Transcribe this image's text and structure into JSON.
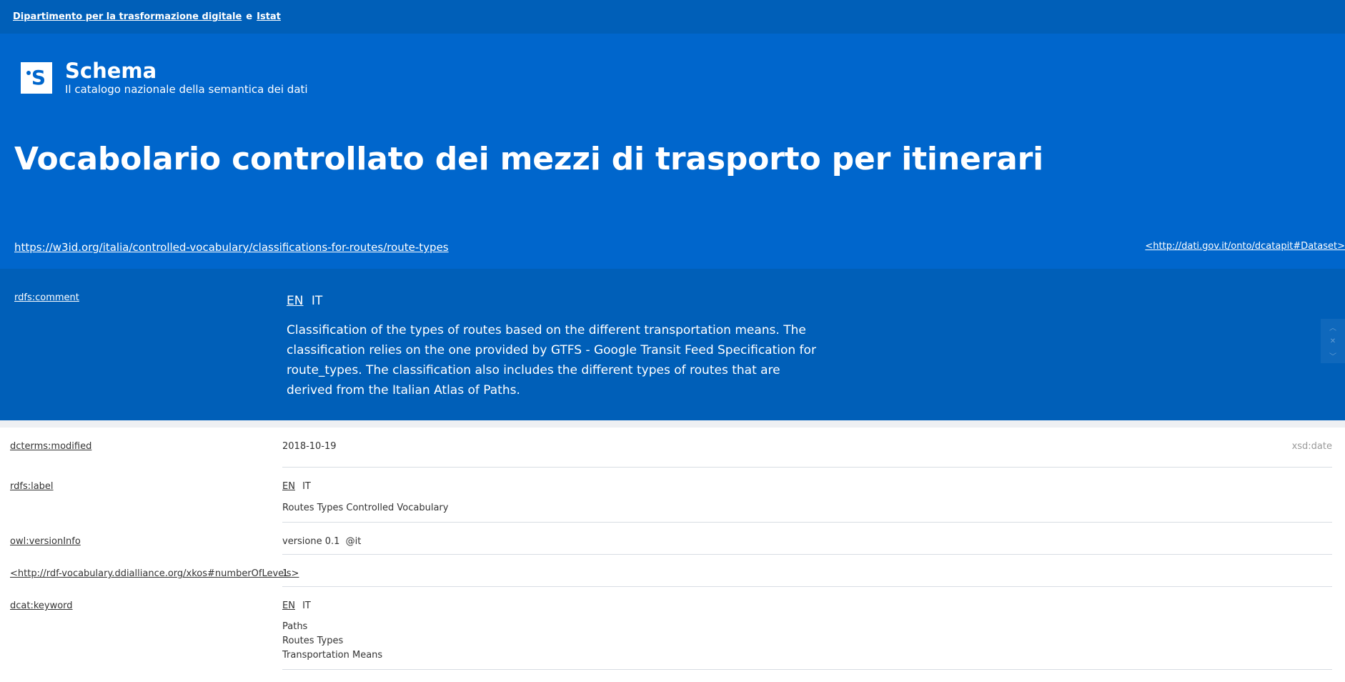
{
  "topbar": {
    "org1": "Dipartimento per la trasformazione digitale",
    "and": "e",
    "org2": "Istat"
  },
  "brand": {
    "title": "Schema",
    "subtitle": "Il catalogo nazionale della semantica dei dati",
    "logo_letter": "S"
  },
  "page": {
    "title": "Vocabolario controllato dei mezzi di trasporto per itinerari",
    "uri": "https://w3id.org/italia/controlled-vocabulary/classifications-for-routes/route-types",
    "type_uri": "<http://dati.gov.it/onto/dcatapit#Dataset>"
  },
  "comment": {
    "prop": "rdfs:comment",
    "lang_en": "EN",
    "lang_it": "IT",
    "text": "Classification of the types of routes based on the different transportation means. The classification relies on the one provided by GTFS - Google Transit Feed Specification for route_types. The classification also includes the different types of routes that are derived from the Italian Atlas of Paths."
  },
  "properties": {
    "modified": {
      "key": "dcterms:modified",
      "value": "2018-10-19",
      "type": "xsd:date"
    },
    "label": {
      "key": "rdfs:label",
      "lang_en": "EN",
      "lang_it": "IT",
      "value": "Routes Types Controlled Vocabulary"
    },
    "version": {
      "key": "owl:versionInfo",
      "value": "versione 0.1  @it"
    },
    "levels": {
      "key": "<http://rdf-vocabulary.ddialliance.org/xkos#numberOfLevels>",
      "value": "1"
    },
    "keyword": {
      "key": "dcat:keyword",
      "lang_en": "EN",
      "lang_it": "IT",
      "values": [
        "Paths",
        "Routes Types",
        "Transportation Means"
      ]
    }
  },
  "colors": {
    "topbar": "#005fb8",
    "hero": "#0066cc",
    "comment_band": "#005fb8",
    "separator": "#eef0f3"
  },
  "icons": {
    "scroll_up": "chevron-up-icon",
    "scroll_close": "close-icon",
    "scroll_down": "chevron-down-icon"
  }
}
